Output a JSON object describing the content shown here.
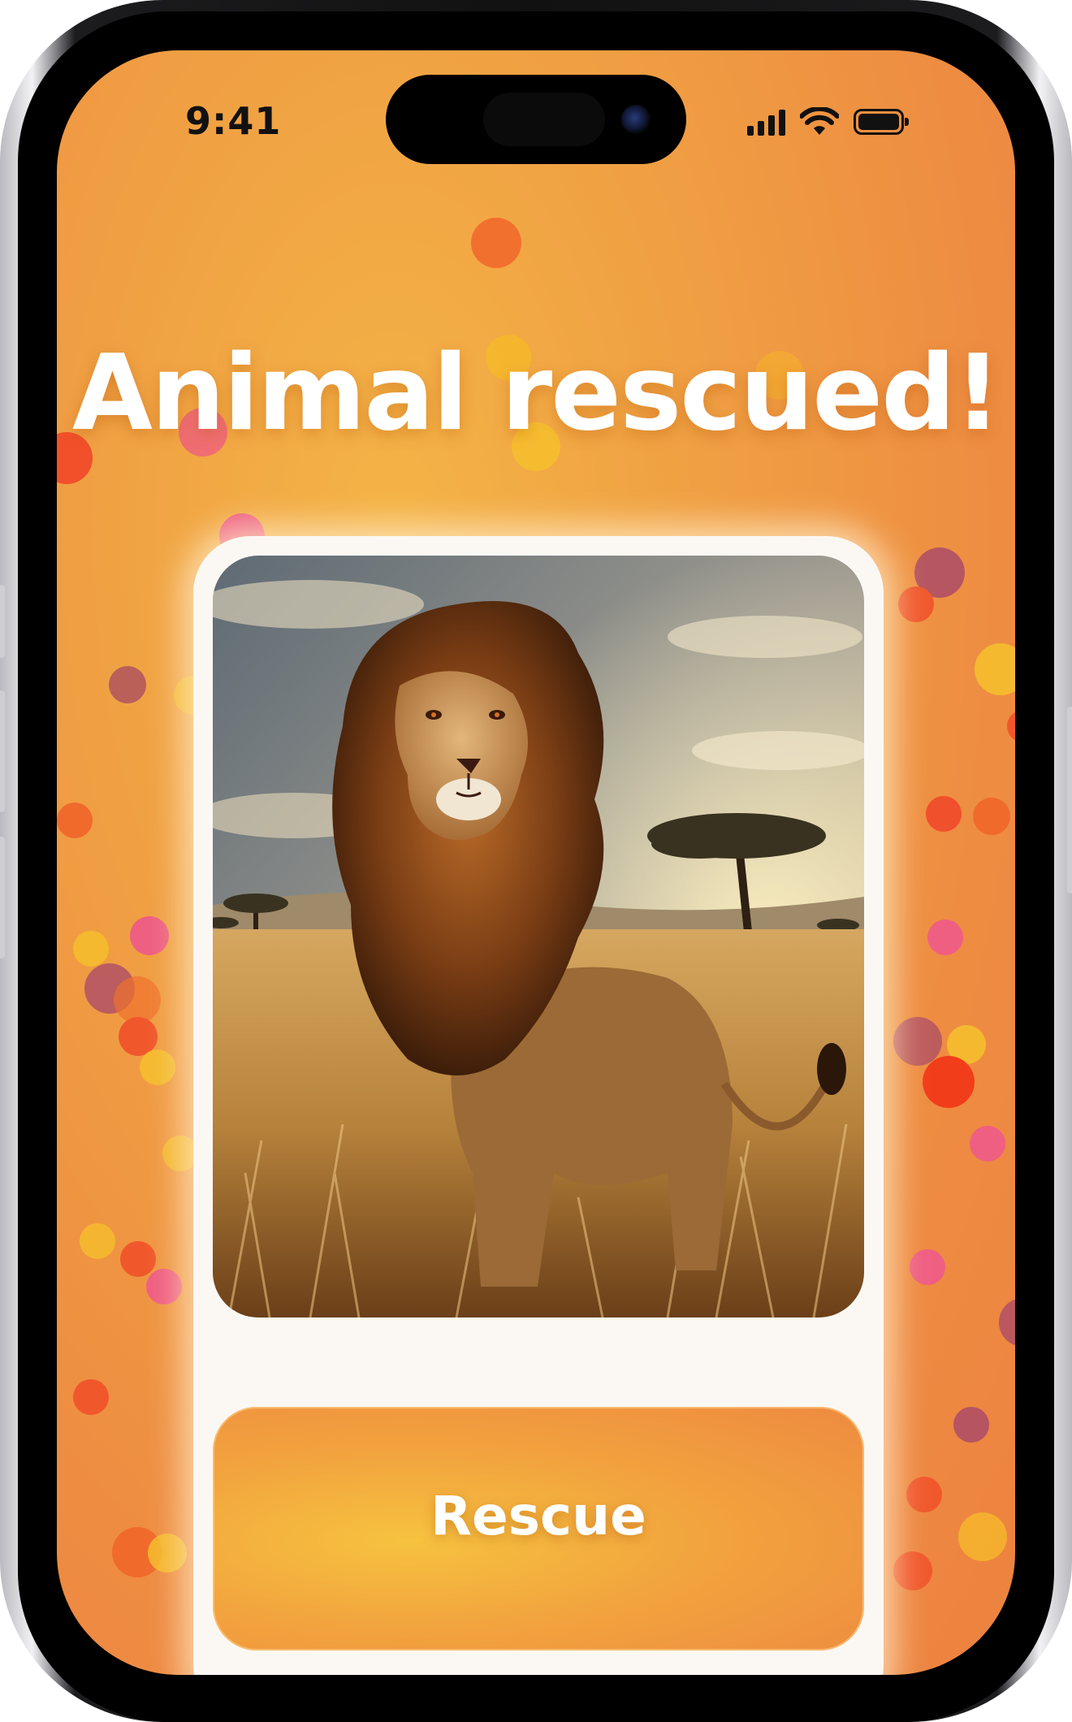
{
  "status_bar": {
    "time": "9:41"
  },
  "title": "Animal rescued!",
  "rescue_button": {
    "label": "Rescue"
  },
  "colors": {
    "background_orange": "#ee8c42",
    "card_background": "#fbf8f4",
    "button_gold": "#f6c23f",
    "title_text": "#ffffff"
  },
  "photo": {
    "subject": "lion-in-savanna-image"
  }
}
